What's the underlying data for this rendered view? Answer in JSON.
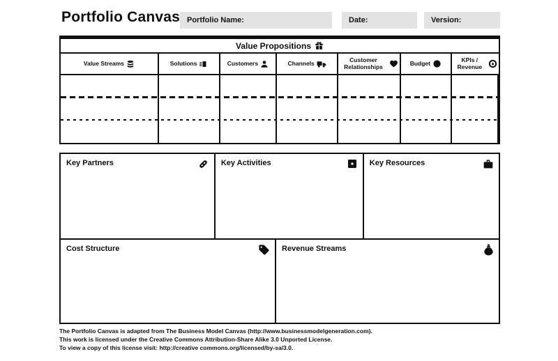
{
  "header": {
    "title": "Portfolio Canvas",
    "fields": [
      {
        "label": "Portfolio Name:",
        "value": "",
        "name": "portfolio-name"
      },
      {
        "label": "Date:",
        "value": "",
        "name": "date"
      },
      {
        "label": "Version:",
        "value": "",
        "name": "version"
      }
    ]
  },
  "value_propositions": {
    "title": "Value Propositions",
    "icon": "gift-icon",
    "columns": [
      {
        "label": "Value Streams",
        "icon": "coins-stack-icon"
      },
      {
        "label": "Solutions",
        "icon": "product-box-icon"
      },
      {
        "label": "Customers",
        "icon": "person-icon"
      },
      {
        "label": "Channels",
        "icon": "truck-icon"
      },
      {
        "label": "Customer Relationships",
        "icon": "heart-icon"
      },
      {
        "label": "Budget",
        "icon": "coin-icon"
      },
      {
        "label": "KPIs / Revenue",
        "icon": "coin-dollar-icon"
      }
    ]
  },
  "sections": {
    "middle": [
      {
        "label": "Key Partners",
        "icon": "link-icon"
      },
      {
        "label": "Key Activities",
        "icon": "checkbox-icon"
      },
      {
        "label": "Key Resources",
        "icon": "briefcase-icon"
      }
    ],
    "bottom": [
      {
        "label": "Cost Structure",
        "icon": "price-tag-icon"
      },
      {
        "label": "Revenue Streams",
        "icon": "money-bag-icon"
      }
    ]
  },
  "footer": {
    "lines": [
      "The Portfolio Canvas is adapted from The Business Model Canvas (http://www.businessmodelgeneration.com).",
      "This work is licensed under the Creative Commons Attribution-Share Alike 3.0 Unported License.",
      "To view a copy of this license visit: http://creative commons.org/licensed/by-sa/3.0."
    ]
  },
  "colors": {
    "border": "#101010",
    "field_background": "#e3e3e3",
    "text": "#101010"
  }
}
